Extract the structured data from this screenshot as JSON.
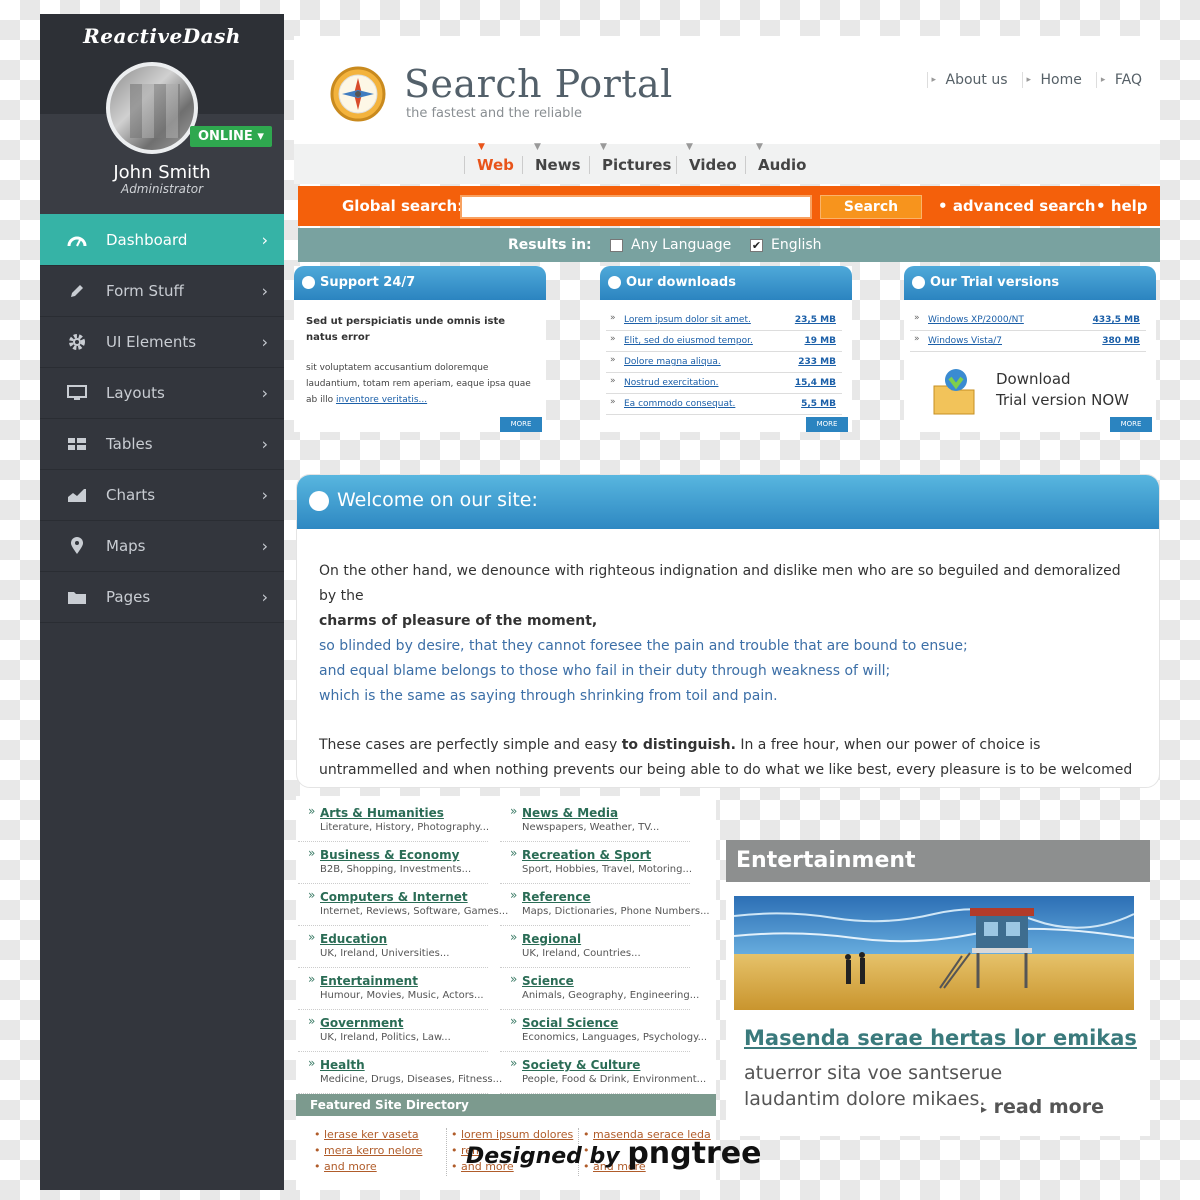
{
  "sidebar": {
    "brand": "ReactiveDash",
    "status": "ONLINE",
    "user_name": "John Smith",
    "user_role": "Administrator",
    "items": [
      {
        "label": "Dashboard",
        "icon": "dashboard-icon"
      },
      {
        "label": "Form Stuff",
        "icon": "pencil-icon"
      },
      {
        "label": "UI Elements",
        "icon": "gear-icon"
      },
      {
        "label": "Layouts",
        "icon": "monitor-icon"
      },
      {
        "label": "Tables",
        "icon": "table-icon"
      },
      {
        "label": "Charts",
        "icon": "chart-icon"
      },
      {
        "label": "Maps",
        "icon": "map-pin-icon"
      },
      {
        "label": "Pages",
        "icon": "folder-icon"
      }
    ]
  },
  "header": {
    "title": "Search Portal",
    "tagline": "the fastest and the reliable",
    "links": [
      "About us",
      "Home",
      "FAQ"
    ]
  },
  "tabs": [
    "Web",
    "News",
    "Pictures",
    "Video",
    "Audio"
  ],
  "search": {
    "label": "Global search:",
    "value": "",
    "button": "Search",
    "advanced": "advanced search",
    "help": "help"
  },
  "results": {
    "label": "Results in:",
    "options": [
      {
        "label": "Any Language",
        "checked": false
      },
      {
        "label": "English",
        "checked": true
      }
    ]
  },
  "panels": {
    "support": {
      "title": "Support 24/7",
      "lead": "Sed ut perspiciatis unde omnis iste natus error",
      "text": "sit voluptatem accusantium doloremque laudantium, totam rem aperiam, eaque ipsa quae ab illo",
      "link": "inventore veritatis...",
      "more": "MORE"
    },
    "downloads": {
      "title": "Our downloads",
      "items": [
        {
          "name": "Lorem ipsum dolor sit amet.",
          "size": "23,5 MB"
        },
        {
          "name": "Elit, sed do eiusmod tempor.",
          "size": "19 MB"
        },
        {
          "name": "Dolore magna aliqua.",
          "size": "233 MB"
        },
        {
          "name": "Nostrud exercitation.",
          "size": "15,4 MB"
        },
        {
          "name": "Ea commodo consequat.",
          "size": "5,5 MB"
        }
      ],
      "more": "MORE"
    },
    "trials": {
      "title": "Our Trial versions",
      "items": [
        {
          "name": "Windows XP/2000/NT",
          "size": "433,5 MB"
        },
        {
          "name": "Windows Vista/7",
          "size": "380 MB"
        }
      ],
      "cta_line1": "Download",
      "cta_line2": "Trial version NOW",
      "more": "MORE"
    }
  },
  "welcome": {
    "title": "Welcome on our site:",
    "p1_a": "On the other hand, we denounce with righteous indignation and dislike men who are so beguiled and demoralized by the",
    "p1_bold": "charms of pleasure of the moment,",
    "p1_blue1": "so blinded by desire, that they cannot foresee the pain and trouble that are bound to ensue;",
    "p1_blue2": "and equal blame belongs to those who fail in their duty through weakness of will;",
    "p1_blue3": "which is the same as saying through shrinking from toil and pain.",
    "p2_a": "These cases are perfectly simple and easy",
    "p2_bold": "to distinguish.",
    "p2_b": "In a free hour, when our power of choice is untrammelled and when nothing prevents our being able to do what we like best, every pleasure is to be welcomed and every pain avoided."
  },
  "directory": [
    {
      "title": "Arts & Humanities",
      "desc": "Literature, History, Photography..."
    },
    {
      "title": "News & Media",
      "desc": "Newspapers, Weather, TV..."
    },
    {
      "title": "Business & Economy",
      "desc": "B2B, Shopping, Investments..."
    },
    {
      "title": "Recreation & Sport",
      "desc": "Sport, Hobbies, Travel, Motoring..."
    },
    {
      "title": "Computers & Internet",
      "desc": "Internet, Reviews, Software, Games..."
    },
    {
      "title": "Reference",
      "desc": "Maps, Dictionaries, Phone Numbers..."
    },
    {
      "title": "Education",
      "desc": "UK, Ireland, Universities..."
    },
    {
      "title": "Regional",
      "desc": "UK, Ireland, Countries..."
    },
    {
      "title": "Entertainment",
      "desc": "Humour, Movies, Music, Actors..."
    },
    {
      "title": "Science",
      "desc": "Animals, Geography, Engineering..."
    },
    {
      "title": "Government",
      "desc": "UK, Ireland, Politics, Law..."
    },
    {
      "title": "Social Science",
      "desc": "Economics, Languages, Psychology..."
    },
    {
      "title": "Health",
      "desc": "Medicine, Drugs, Diseases, Fitness..."
    },
    {
      "title": "Society & Culture",
      "desc": "People, Food & Drink, Environment..."
    }
  ],
  "featured": {
    "title": "Featured Site Directory",
    "columns": [
      [
        "lerase ker vaseta",
        "mera kerro nelore",
        "and more"
      ],
      [
        "lorem ipsum dolores",
        "rem",
        "and more"
      ],
      [
        "masenda serace leda",
        "",
        "and more"
      ]
    ]
  },
  "entertainment": {
    "title": "Entertainment",
    "headline": "Masenda serae hertas lor emikas",
    "text": "atuerror sita voe santserue laudantim dolore mikaes.",
    "read_more": "read more"
  },
  "watermark": {
    "prefix": "Designed by",
    "brand": "pngtree"
  },
  "colors": {
    "teal": "#36b3a6",
    "orange": "#f4600b",
    "panel_blue": "#2b84c0",
    "sidebar": "#33363d"
  }
}
